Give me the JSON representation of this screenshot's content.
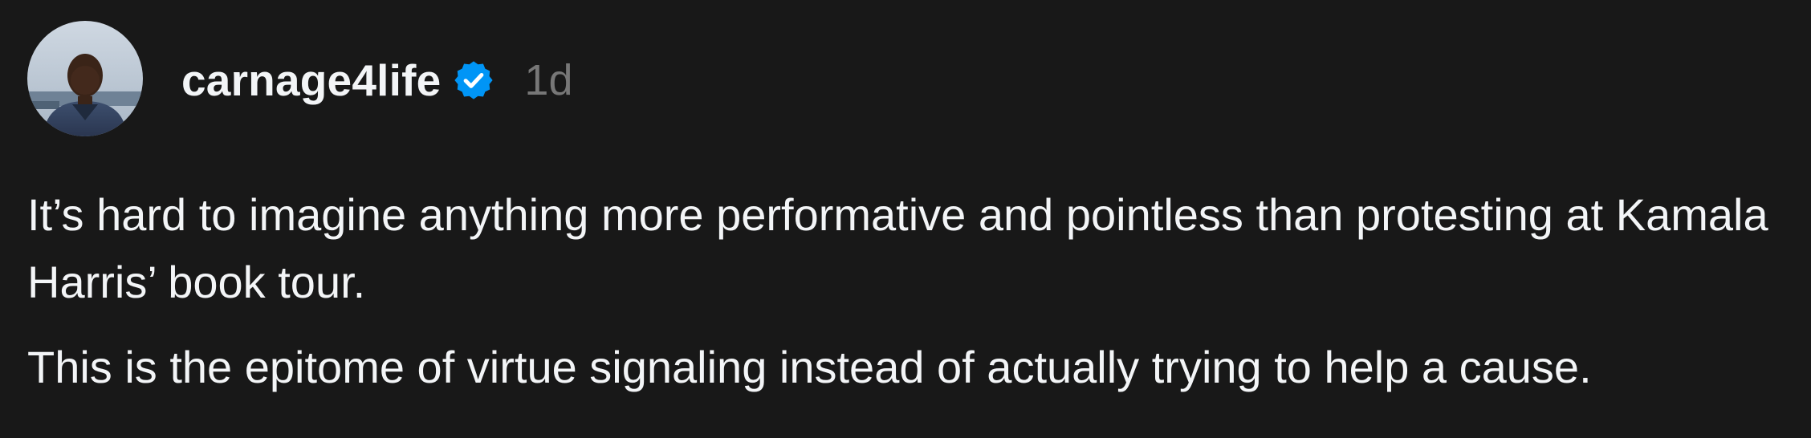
{
  "post": {
    "username": "carnage4life",
    "timestamp": "1d",
    "verified": true,
    "paragraphs": [
      "It’s hard to imagine anything more performative and pointless than protesting at Kamala Harris’ book tour.",
      "This is the epitome of virtue signaling instead of actually trying to help a cause."
    ]
  },
  "icons": {
    "avatar": "user-avatar-photo",
    "verified": "verified-badge-icon"
  },
  "colors": {
    "background": "#181818",
    "primary_text": "#f3f5f7",
    "secondary_text": "#777777",
    "verified_blue": "#0095f6"
  }
}
